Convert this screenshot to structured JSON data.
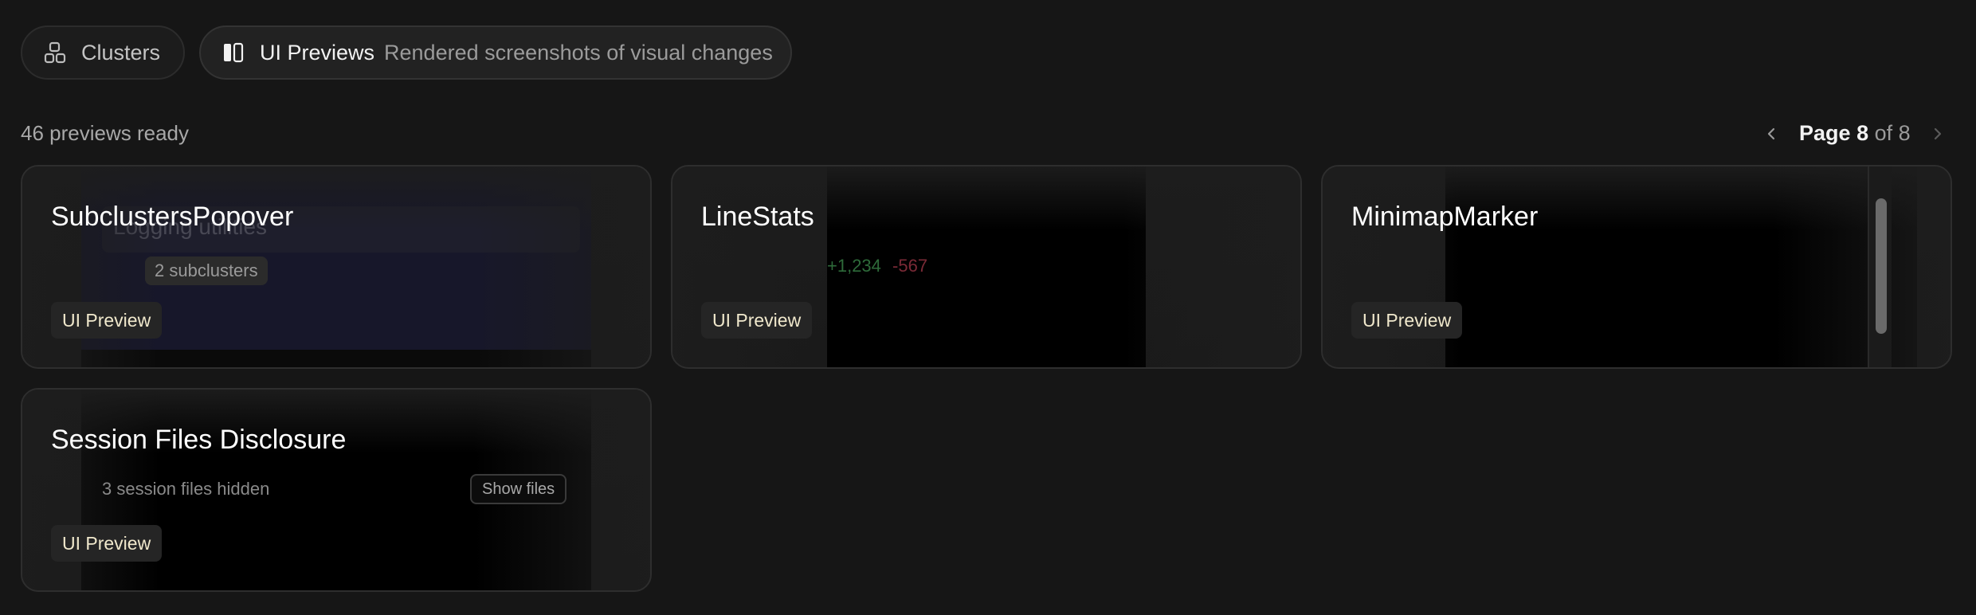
{
  "tabs": {
    "clusters": {
      "label": "Clusters",
      "icon": "clusters-icon"
    },
    "previews": {
      "label": "UI Previews",
      "description": "Rendered screenshots of visual changes",
      "icon": "preview-panel-icon"
    }
  },
  "summary": {
    "count_text": "46 previews ready"
  },
  "pagination": {
    "page_word": "Page",
    "current": "8",
    "of_word": "of",
    "total": "8"
  },
  "cards": [
    {
      "title": "SubclustersPopover",
      "badge": "UI Preview",
      "preview": {
        "ghost_text": "Logging utilities",
        "chip": "2 subclusters"
      }
    },
    {
      "title": "LineStats",
      "badge": "UI Preview",
      "preview": {
        "additions": "+1,234",
        "deletions": "-567"
      }
    },
    {
      "title": "MinimapMarker",
      "badge": "UI Preview",
      "preview": {}
    },
    {
      "title": "Session Files Disclosure",
      "badge": "UI Preview",
      "preview": {
        "hidden_text": "3 session files hidden",
        "button": "Show files"
      }
    }
  ],
  "colors": {
    "background": "#161616",
    "badge_text": "#f0e8cc",
    "additions": "#2e6b3a",
    "deletions": "#7a2a36"
  }
}
